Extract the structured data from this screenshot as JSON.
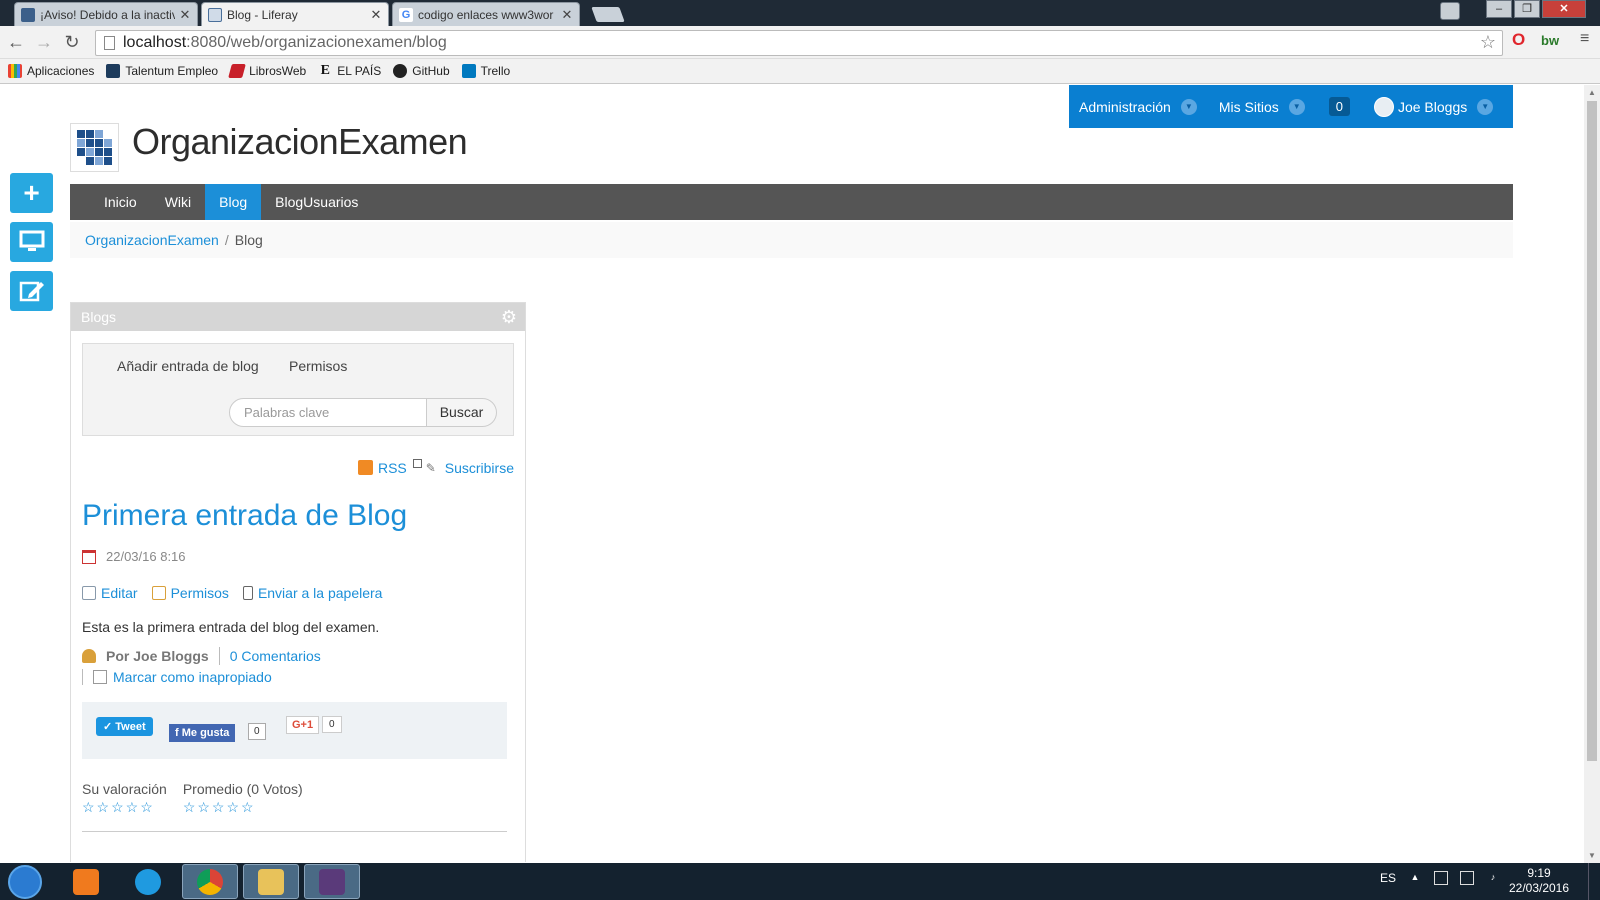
{
  "browser": {
    "tabs": [
      {
        "title": "¡Aviso! Debido a la inactiv",
        "active": false
      },
      {
        "title": "Blog - Liferay",
        "active": true
      },
      {
        "title": "codigo enlaces www3wor",
        "active": false
      }
    ],
    "address": {
      "host": "localhost",
      "rest": ":8080/web/organizacionexamen/blog"
    },
    "extensions": {
      "bw_label": "bw"
    },
    "bookmarks": [
      {
        "label": "Aplicaciones",
        "icon": "apps-grid-icon"
      },
      {
        "label": "Talentum Empleo",
        "icon": "talentum-icon"
      },
      {
        "label": "LibrosWeb",
        "icon": "librosweb-icon"
      },
      {
        "label": "EL PAÍS",
        "icon": "elpais-icon",
        "glyph": "E"
      },
      {
        "label": "GitHub",
        "icon": "github-icon"
      },
      {
        "label": "Trello",
        "icon": "trello-icon"
      }
    ]
  },
  "dockbar": {
    "admin_label": "Administración",
    "sites_label": "Mis Sitios",
    "notifications": "0",
    "user_name": "Joe Bloggs"
  },
  "site": {
    "title": "OrganizacionExamen",
    "nav": [
      {
        "label": "Inicio",
        "selected": false
      },
      {
        "label": "Wiki",
        "selected": false
      },
      {
        "label": "Blog",
        "selected": true
      },
      {
        "label": "BlogUsuarios",
        "selected": false
      }
    ],
    "breadcrumb": {
      "root": "OrganizacionExamen",
      "current": "Blog",
      "sep": "/"
    }
  },
  "portlet": {
    "title": "Blogs",
    "toolbox": {
      "add_entry": "Añadir entrada de blog",
      "permissions": "Permisos",
      "search_placeholder": "Palabras clave",
      "search_button": "Buscar"
    },
    "feeds": {
      "rss": "RSS",
      "subscribe": "Suscribirse"
    },
    "entry": {
      "title": "Primera entrada de Blog",
      "date": "22/03/16 8:16",
      "actions": {
        "edit": "Editar",
        "permissions": "Permisos",
        "trash": "Enviar a la papelera"
      },
      "body": "Esta es la primera entrada del blog del examen.",
      "author": "Por Joe Bloggs",
      "comments": "0 Comentarios",
      "flag": "Marcar como inapropiado"
    },
    "social": {
      "tweet": "Tweet",
      "fb_like": "Me gusta",
      "fb_count": "0",
      "gplus": "G+1",
      "gplus_count": "0"
    },
    "ratings": {
      "yours_label": "Su valoración",
      "yours_stars": "☆☆☆☆☆",
      "average_label": "Promedio (0 Votos)",
      "average_stars": "☆☆☆☆☆"
    }
  },
  "taskbar": {
    "apps": [
      "start-icon",
      "media-player-icon",
      "internet-explorer-icon",
      "chrome-icon",
      "file-explorer-icon",
      "java-ee-eclipse-icon"
    ],
    "language": "ES",
    "time": "9:19",
    "date": "22/03/2016"
  },
  "colors": {
    "accent": "#1c8fd8",
    "dockbar": "#0a7fd1",
    "nav_bar": "#555555",
    "side_buttons": "#28a8e0"
  }
}
